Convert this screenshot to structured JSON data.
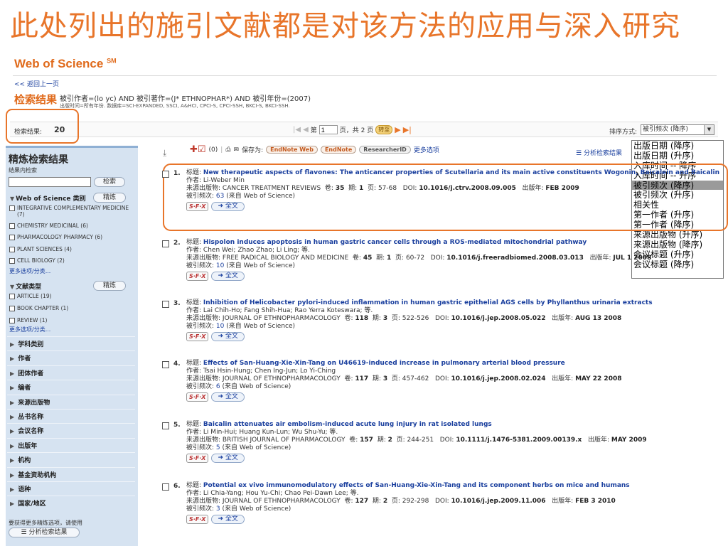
{
  "slide_title": "此处列出的施引文献都是对该方法的应用与深入研究",
  "wos": {
    "brand": "Web of Science",
    "sm": "SM",
    "back": "<< 返回上一页"
  },
  "search": {
    "results_label": "检索结果",
    "query": "被引作者=(lo yc) AND 被引著作=(J* ETHNOPHAR*) AND 被引年份=(2007)",
    "databases": "出版时间=所有年份. 数据库=SCI-EXPANDED, SSCI, A&HCI, CPCI-S, CPCI-SSH, BKCI-S, BKCI-SSH.",
    "count_label": "检索结果:",
    "count": "20"
  },
  "pager": {
    "page_label": "第",
    "page": "1",
    "total": "页，共 2 页",
    "go": "转至"
  },
  "sort": {
    "label": "排序方式:",
    "selected": "被引频次 (降序)",
    "options": [
      "出版日期 (降序)",
      "出版日期 (升序)",
      "入库时间 -- 降序",
      "入库时间 -- 升序",
      "被引频次 (降序)",
      "被引频次 (升序)",
      "相关性",
      "第一作者 (升序)",
      "第一作者 (降序)",
      "来源出版物 (升序)",
      "来源出版物 (降序)",
      "会议标题 (升序)",
      "会议标题 (降序)"
    ]
  },
  "toolbar": {
    "marked": "(0)",
    "save_to": "保存为:",
    "endnote_web": "EndNote Web",
    "endnote": "EndNote",
    "researcherid": "ResearcherID",
    "more": "更多选项",
    "analyze": "分析检索结果"
  },
  "sidebar": {
    "title": "精炼检索结果",
    "sub": "结果内检索",
    "search_btn": "检索",
    "refine_btn": "精炼",
    "wos_category": "Web of Science 类别",
    "categories": [
      "INTEGRATIVE COMPLEMENTARY MEDICINE (7)",
      "CHEMISTRY MEDICINAL (6)",
      "PHARMACOLOGY PHARMACY (6)",
      "PLANT SCIENCES (4)",
      "CELL BIOLOGY (2)"
    ],
    "more": "更多选项/分类...",
    "doc_type": "文献类型",
    "doc_types": [
      "ARTICLE (19)",
      "BOOK CHAPTER (1)",
      "REVIEW (1)"
    ],
    "collapsed": [
      "学科类别",
      "作者",
      "团体作者",
      "编者",
      "来源出版物",
      "丛书名称",
      "会议名称",
      "出版年",
      "机构",
      "基金资助机构",
      "语种",
      "国家/地区"
    ],
    "foot": "要获得更多精炼选项，请使用",
    "analyze_btn": "☰ 分析检索结果"
  },
  "labels": {
    "title": "标题:",
    "author": "作者:",
    "source": "来源出版物:",
    "volume": "卷:",
    "issue": "期:",
    "pages": "页:",
    "doi": "DOI:",
    "pubyear": "出版年:",
    "cited": "被引频次:",
    "from_wos": "(来自 Web of Science)",
    "sfx": "S·F·X",
    "fulltext": "➜ 全文"
  },
  "records": [
    {
      "num": "1.",
      "title": "New therapeutic aspects of flavones: The anticancer properties of Scutellaria and its main active constituents Wogonin, Baicalein and Baicalin",
      "authors": "Li-Weber Min",
      "source": "CANCER TREATMENT REVIEWS",
      "volume": "35",
      "issue": "1",
      "pages": "57-68",
      "doi": "10.1016/j.ctrv.2008.09.005",
      "pubyear": "FEB 2009",
      "cited": "63"
    },
    {
      "num": "2.",
      "title": "Hispolon induces apoptosis in human gastric cancer cells through a ROS-mediated mitochondrial pathway",
      "authors": "Chen Wei; Zhao Zhao; Li Ling; 等.",
      "source": "FREE RADICAL BIOLOGY AND MEDICINE",
      "volume": "45",
      "issue": "1",
      "pages": "60-72",
      "doi": "10.1016/j.freeradbiomed.2008.03.013",
      "pubyear": "JUL 1 2008",
      "cited": "10"
    },
    {
      "num": "3.",
      "title": "Inhibition of Helicobacter pylori-induced inflammation in human gastric epithelial AGS cells by Phyllanthus urinaria extracts",
      "authors": "Lai Chih-Ho; Fang Shih-Hua; Rao Yerra Koteswara; 等.",
      "source": "JOURNAL OF ETHNOPHARMACOLOGY",
      "volume": "118",
      "issue": "3",
      "pages": "522-526",
      "doi": "10.1016/j.jep.2008.05.022",
      "pubyear": "AUG 13 2008",
      "cited": "10"
    },
    {
      "num": "4.",
      "title": "Effects of San-Huang-Xie-Xin-Tang on U46619-induced increase in pulmonary arterial blood pressure",
      "authors": "Tsai Hsin-Hung; Chen Ing-Jun; Lo Yi-Ching",
      "source": "JOURNAL OF ETHNOPHARMACOLOGY",
      "volume": "117",
      "issue": "3",
      "pages": "457-462",
      "doi": "10.1016/j.jep.2008.02.024",
      "pubyear": "MAY 22 2008",
      "cited": "6"
    },
    {
      "num": "5.",
      "title": "Baicalin attenuates air embolism-induced acute lung injury in rat isolated lungs",
      "authors": "Li Min-Hui; Huang Kun-Lun; Wu Shu-Yu; 等.",
      "source": "BRITISH JOURNAL OF PHARMACOLOGY",
      "volume": "157",
      "issue": "2",
      "pages": "244-251",
      "doi": "10.1111/j.1476-5381.2009.00139.x",
      "pubyear": "MAY 2009",
      "cited": "5"
    },
    {
      "num": "6.",
      "title": "Potential ex vivo immunomodulatory effects of San-Huang-Xie-Xin-Tang and its component herbs on mice and humans",
      "authors": "Li Chia-Yang; Hou Yu-Chi; Chao Pei-Dawn Lee; 等.",
      "source": "JOURNAL OF ETHNOPHARMACOLOGY",
      "volume": "127",
      "issue": "2",
      "pages": "292-298",
      "doi": "10.1016/j.jep.2009.11.006",
      "pubyear": "FEB 3 2010",
      "cited": "3"
    }
  ]
}
